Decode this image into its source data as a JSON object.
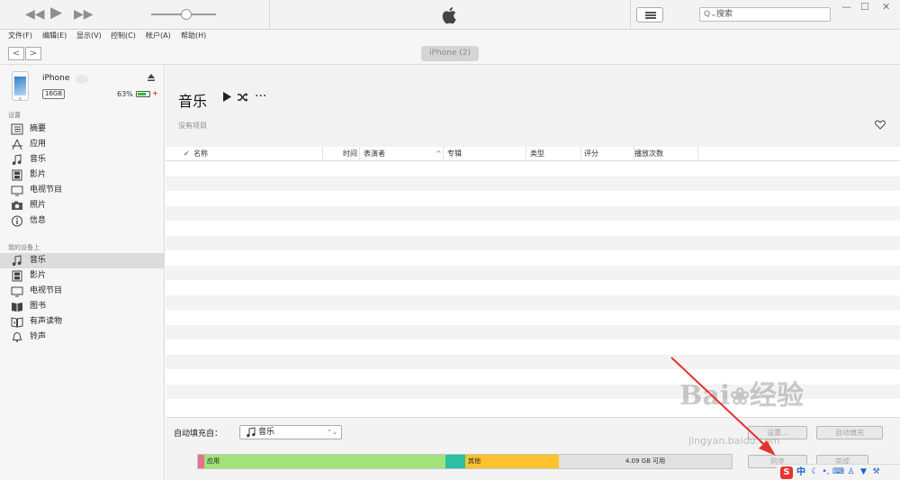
{
  "search": {
    "placeholder": "搜索"
  },
  "menu": [
    "文件(F)",
    "编辑(E)",
    "显示(V)",
    "控制(C)",
    "帐户(A)",
    "帮助(H)"
  ],
  "nav": {
    "back": "<",
    "forward": ">",
    "device_pill": "iPhone  (2)"
  },
  "device": {
    "name": "iPhone",
    "capacity": "16GB",
    "battery_pct": "63%",
    "battery_level": 0.63
  },
  "sidebar": {
    "settings_header": "设置",
    "settings_items": [
      "摘要",
      "应用",
      "音乐",
      "影片",
      "电视节目",
      "照片",
      "信息"
    ],
    "mydevice_header": "我的设备上",
    "mydevice_items": [
      "音乐",
      "影片",
      "电视节目",
      "图书",
      "有声读物",
      "铃声"
    ],
    "active_mydevice_index": 0
  },
  "main": {
    "title": "音乐",
    "no_items": "没有项目",
    "more": "···",
    "columns": {
      "check": "✓",
      "name": "名称",
      "time": "时间",
      "artist": "表演者",
      "album": "专辑",
      "genre": "类型",
      "rating": "评分",
      "plays": "播放次数"
    }
  },
  "bottom": {
    "autofill_label": "自动填充自：",
    "autofill_value": "音乐",
    "settings_btn": "设置...",
    "autofill_btn": "自动填充",
    "sync_btn": "同步",
    "done_btn": "完成"
  },
  "storage": {
    "apps_label": "应用",
    "other_label": "其他",
    "free_label": "4.09 GB 可用",
    "segments": [
      {
        "name": "audio",
        "color": "#e7728b",
        "fraction": 0.011
      },
      {
        "name": "apps",
        "color": "#9fe37a",
        "fraction": 0.452
      },
      {
        "name": "teal",
        "color": "#2cbfa3",
        "fraction": 0.037
      },
      {
        "name": "other",
        "color": "#fdc22d",
        "fraction": 0.175
      },
      {
        "name": "free",
        "color": "#e1e1e1",
        "fraction": 0.325
      }
    ]
  },
  "watermark": {
    "brand": "Bai",
    "brand2": "经验",
    "sub": "jingyan.baidu.com"
  },
  "ime": {
    "logo": "S",
    "mode": "中"
  },
  "colors": {
    "accent_blue": "#1466c6",
    "active_row": "#dcdcdc",
    "battery_green": "#2bbd2b",
    "arrow_red": "#e5322d"
  }
}
